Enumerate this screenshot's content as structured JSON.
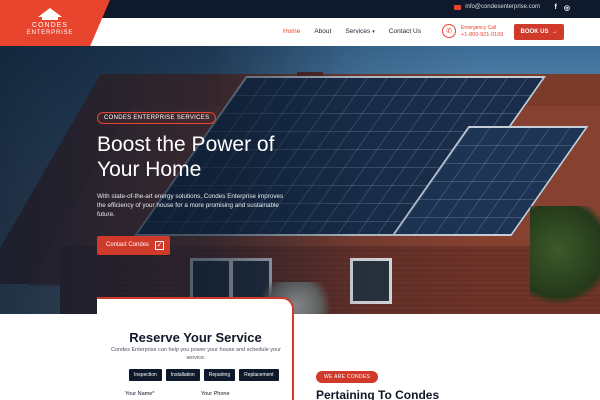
{
  "topbar": {
    "email": "info@condesenterprise.com",
    "social": [
      "f",
      "◎"
    ]
  },
  "logo": {
    "line1": "CONDES",
    "line2": "ENTERPRISE"
  },
  "nav": {
    "items": [
      {
        "label": "Home"
      },
      {
        "label": "About"
      },
      {
        "label": "Services"
      },
      {
        "label": "Contact Us"
      }
    ],
    "emergency_label": "Emergency Call",
    "emergency_number": "+1-800-921-0169",
    "book_label": "BOOK US"
  },
  "hero": {
    "tag": "CONDES ENTERPRISE SERVICES",
    "title_line1": "Boost the Power of",
    "title_line2": "Your Home",
    "description": "With state-of-the-art energy solutions, Condes Enterprise improves the efficiency of your house for a more promising and sustainable future.",
    "cta_label": "Contact Condes"
  },
  "reserve": {
    "title": "Reserve Your Service",
    "description": "Condes Enterprise can help you power your house and schedule your service.",
    "service_types": [
      "Inspection",
      "Installation",
      "Repairing",
      "Replacement"
    ],
    "name_label": "Your Name*",
    "phone_label": "Your Phone"
  },
  "about": {
    "badge": "WE ARE CONDES",
    "heading": "Pertaining To Condes"
  },
  "colors": {
    "accent": "#cf3a2a",
    "dark": "#0e1a2b"
  }
}
